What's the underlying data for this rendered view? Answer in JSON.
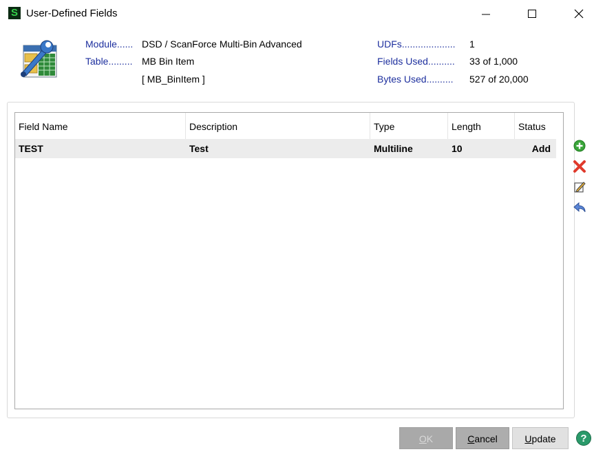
{
  "window": {
    "app_icon_letter": "S",
    "title": "User-Defined Fields"
  },
  "info": {
    "module_label": "Module......",
    "module_value": "DSD / ScanForce Multi-Bin Advanced",
    "table_label": "Table.........",
    "table_value": "MB Bin Item",
    "table_id": "[ MB_BinItem ]",
    "udfs_label": "UDFs....................",
    "udfs_value": "1",
    "fields_used_label": "Fields Used..........",
    "fields_used_value": "33 of 1,000",
    "bytes_used_label": "Bytes Used..........",
    "bytes_used_value": "527 of 20,000"
  },
  "grid": {
    "columns": [
      "Field Name",
      "Description",
      "Type",
      "Length",
      "Status"
    ],
    "rows": [
      [
        "TEST",
        "Test",
        "Multiline",
        "10",
        "Add"
      ]
    ]
  },
  "side_icons": [
    "add-icon",
    "delete-icon",
    "edit-icon",
    "undo-icon"
  ],
  "buttons": {
    "ok_first": "O",
    "ok_rest": "K",
    "cancel_first": "C",
    "cancel_rest": "ancel",
    "update_first": "U",
    "update_rest": "pdate"
  },
  "colors": {
    "label_blue": "#1d2f9e",
    "selected_row": "#ececec",
    "add_green": "#3aa53a",
    "delete_red": "#e03a2c",
    "help_teal": "#2a9a6a"
  }
}
